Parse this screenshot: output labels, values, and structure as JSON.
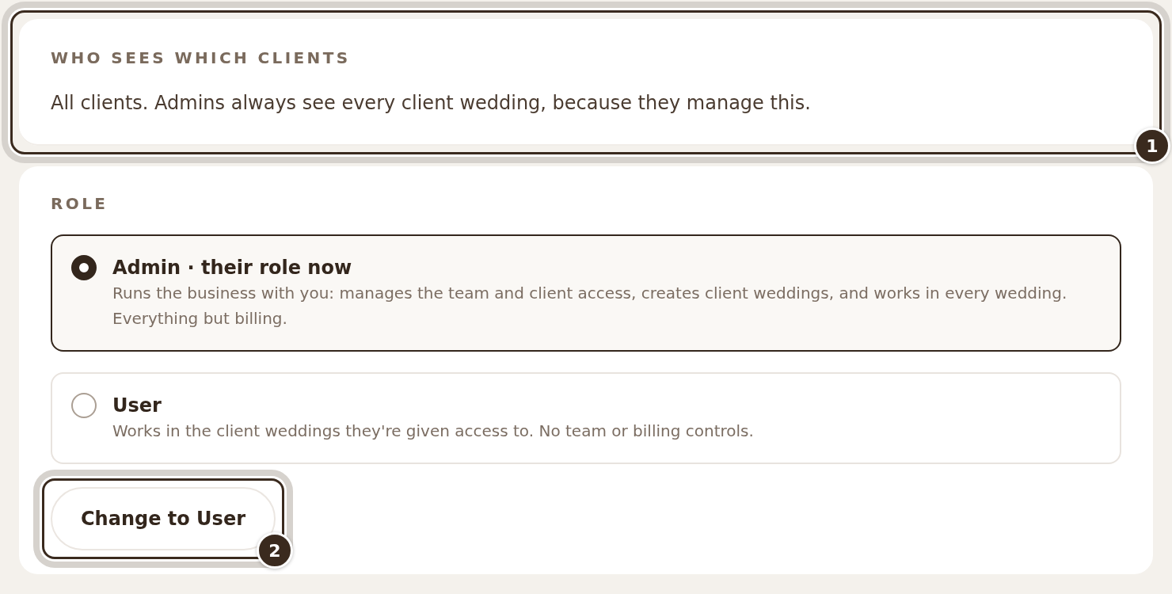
{
  "visibility_card": {
    "heading": "WHO SEES WHICH CLIENTS",
    "text": "All clients. Admins always see every client wedding, because they manage this.",
    "callout": "1"
  },
  "role_section": {
    "heading": "ROLE",
    "options": [
      {
        "title": "Admin · their role now",
        "description": "Runs the business with you: manages the team and client access, creates client weddings, and works in every wedding. Everything but billing.",
        "selected": true
      },
      {
        "title": "User",
        "description": "Works in the client weddings they're given access to. No team or billing controls.",
        "selected": false
      }
    ],
    "action_button": {
      "label": "Change to User",
      "callout": "2"
    }
  }
}
